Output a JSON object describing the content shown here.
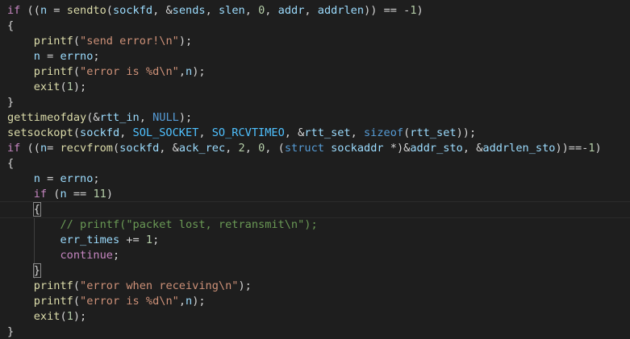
{
  "colors": {
    "background": "#1e1e1e",
    "keyword": "#c586c0",
    "type": "#569cd6",
    "function": "#dcdcaa",
    "variable": "#9cdcfe",
    "number": "#b5cea8",
    "string": "#ce9178",
    "comment": "#6a9955",
    "constant": "#4fc1ff",
    "plain": "#d4d4d4"
  },
  "lines": [
    [
      [
        "kw",
        "if"
      ],
      [
        "pl",
        " (("
      ],
      [
        "va",
        "n"
      ],
      [
        "pl",
        " = "
      ],
      [
        "fn",
        "sendto"
      ],
      [
        "pl",
        "("
      ],
      [
        "va",
        "sockfd"
      ],
      [
        "pl",
        ", &"
      ],
      [
        "va",
        "sends"
      ],
      [
        "pl",
        ", "
      ],
      [
        "va",
        "slen"
      ],
      [
        "pl",
        ", "
      ],
      [
        "nu",
        "0"
      ],
      [
        "pl",
        ", "
      ],
      [
        "va",
        "addr"
      ],
      [
        "pl",
        ", "
      ],
      [
        "va",
        "addrlen"
      ],
      [
        "pl",
        ")) == -"
      ],
      [
        "nu",
        "1"
      ],
      [
        "pl",
        ")"
      ]
    ],
    [
      [
        "pl",
        "{"
      ]
    ],
    [
      [
        "pl",
        "    "
      ],
      [
        "fn",
        "printf"
      ],
      [
        "pl",
        "("
      ],
      [
        "st",
        "\"send error!\\n\""
      ],
      [
        "pl",
        ");"
      ]
    ],
    [
      [
        "pl",
        "    "
      ],
      [
        "va",
        "n"
      ],
      [
        "pl",
        " = "
      ],
      [
        "va",
        "errno"
      ],
      [
        "pl",
        ";"
      ]
    ],
    [
      [
        "pl",
        "    "
      ],
      [
        "fn",
        "printf"
      ],
      [
        "pl",
        "("
      ],
      [
        "st",
        "\"error is %d\\n\""
      ],
      [
        "pl",
        ","
      ],
      [
        "va",
        "n"
      ],
      [
        "pl",
        ");"
      ]
    ],
    [
      [
        "pl",
        "    "
      ],
      [
        "fn",
        "exit"
      ],
      [
        "pl",
        "("
      ],
      [
        "nu",
        "1"
      ],
      [
        "pl",
        ");"
      ]
    ],
    [
      [
        "pl",
        "}"
      ]
    ],
    [
      [
        "fn",
        "gettimeofday"
      ],
      [
        "pl",
        "(&"
      ],
      [
        "va",
        "rtt_in"
      ],
      [
        "pl",
        ", "
      ],
      [
        "ty",
        "NULL"
      ],
      [
        "pl",
        ");"
      ]
    ],
    [
      [
        "fn",
        "setsockopt"
      ],
      [
        "pl",
        "("
      ],
      [
        "va",
        "sockfd"
      ],
      [
        "pl",
        ", "
      ],
      [
        "co2",
        "SOL_SOCKET"
      ],
      [
        "pl",
        ", "
      ],
      [
        "co2",
        "SO_RCVTIMEO"
      ],
      [
        "pl",
        ", &"
      ],
      [
        "va",
        "rtt_set"
      ],
      [
        "pl",
        ", "
      ],
      [
        "ty",
        "sizeof"
      ],
      [
        "pl",
        "("
      ],
      [
        "va",
        "rtt_set"
      ],
      [
        "pl",
        "));"
      ]
    ],
    [
      [
        "kw",
        "if"
      ],
      [
        "pl",
        " (("
      ],
      [
        "va",
        "n"
      ],
      [
        "pl",
        "= "
      ],
      [
        "fn",
        "recvfrom"
      ],
      [
        "pl",
        "("
      ],
      [
        "va",
        "sockfd"
      ],
      [
        "pl",
        ", &"
      ],
      [
        "va",
        "ack_rec"
      ],
      [
        "pl",
        ", "
      ],
      [
        "nu",
        "2"
      ],
      [
        "pl",
        ", "
      ],
      [
        "nu",
        "0"
      ],
      [
        "pl",
        ", ("
      ],
      [
        "ty",
        "struct"
      ],
      [
        "pl",
        " "
      ],
      [
        "va",
        "sockaddr"
      ],
      [
        "pl",
        " *)&"
      ],
      [
        "va",
        "addr_sto"
      ],
      [
        "pl",
        ", &"
      ],
      [
        "va",
        "addrlen_sto"
      ],
      [
        "pl",
        "))==-"
      ],
      [
        "nu",
        "1"
      ],
      [
        "pl",
        ")"
      ]
    ],
    [
      [
        "pl",
        "{"
      ]
    ],
    [
      [
        "pl",
        "    "
      ],
      [
        "va",
        "n"
      ],
      [
        "pl",
        " = "
      ],
      [
        "va",
        "errno"
      ],
      [
        "pl",
        ";"
      ]
    ],
    [
      [
        "pl",
        "    "
      ],
      [
        "kw",
        "if"
      ],
      [
        "pl",
        " ("
      ],
      [
        "va",
        "n"
      ],
      [
        "pl",
        " == "
      ],
      [
        "nu",
        "11"
      ],
      [
        "pl",
        ")"
      ]
    ],
    [
      [
        "pl",
        "    "
      ],
      [
        "pl",
        "{"
      ]
    ],
    [
      [
        "pl",
        "        "
      ],
      [
        "co",
        "// printf(\"packet lost, retransmit\\n\");"
      ]
    ],
    [
      [
        "pl",
        "        "
      ],
      [
        "va",
        "err_times"
      ],
      [
        "pl",
        " += "
      ],
      [
        "nu",
        "1"
      ],
      [
        "pl",
        ";"
      ]
    ],
    [
      [
        "pl",
        "        "
      ],
      [
        "kw",
        "continue"
      ],
      [
        "pl",
        ";"
      ]
    ],
    [
      [
        "pl",
        "    "
      ],
      [
        "pl",
        "}"
      ]
    ],
    [
      [
        "pl",
        "    "
      ],
      [
        "fn",
        "printf"
      ],
      [
        "pl",
        "("
      ],
      [
        "st",
        "\"error when receiving\\n\""
      ],
      [
        "pl",
        ");"
      ]
    ],
    [
      [
        "pl",
        "    "
      ],
      [
        "fn",
        "printf"
      ],
      [
        "pl",
        "("
      ],
      [
        "st",
        "\"error is %d\\n\""
      ],
      [
        "pl",
        ","
      ],
      [
        "va",
        "n"
      ],
      [
        "pl",
        ");"
      ]
    ],
    [
      [
        "pl",
        "    "
      ],
      [
        "fn",
        "exit"
      ],
      [
        "pl",
        "("
      ],
      [
        "nu",
        "1"
      ],
      [
        "pl",
        ");"
      ]
    ],
    [
      [
        "pl",
        "}"
      ]
    ]
  ]
}
